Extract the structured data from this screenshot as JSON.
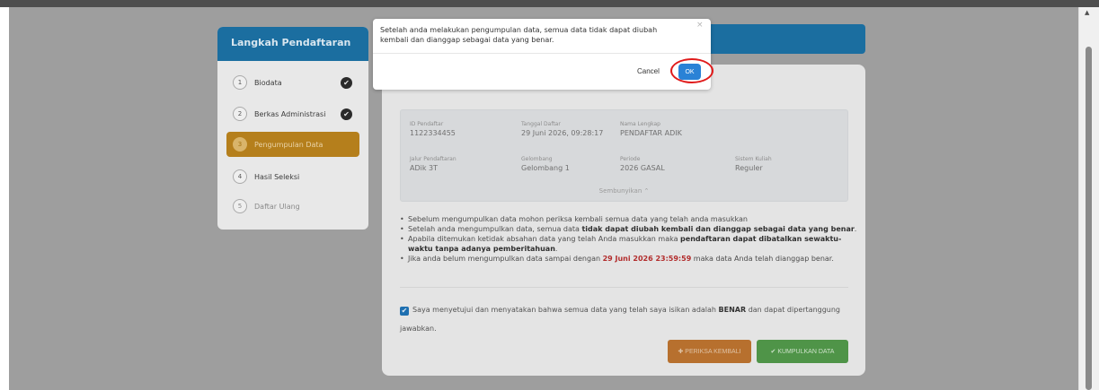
{
  "sidebar": {
    "title": "Langkah Pendaftaran",
    "steps": [
      {
        "num": "1",
        "label": "Biodata",
        "done": "✔"
      },
      {
        "num": "2",
        "label": "Berkas Administrasi",
        "done": "✔"
      },
      {
        "num": "3",
        "label": "Pengumpulan Data"
      },
      {
        "num": "4",
        "label": "Hasil Seleksi"
      },
      {
        "num": "5",
        "label": "Daftar Ulang"
      }
    ]
  },
  "info": {
    "id_label": "ID Pendaftar",
    "id_value": "1122334455",
    "date_label": "Tanggal Daftar",
    "date_value": "29 Juni 2026, 09:28:17",
    "name_label": "Nama Lengkap",
    "name_value": "PENDAFTAR ADIK",
    "jalur_label": "Jalur Pendaftaran",
    "jalur_value": "ADik 3T",
    "gel_label": "Gelombang",
    "gel_value": "Gelombang 1",
    "periode_label": "Periode",
    "periode_value": "2026 GASAL",
    "sistem_label": "Sistem Kuliah",
    "sistem_value": "Reguler",
    "hide_link": "Sembunyikan ⌃"
  },
  "notes": {
    "n1": "Sebelum mengumpulkan data mohon periksa kembali semua data yang telah anda masukkan",
    "n2_pre": "Setelah anda mengumpulkan data, semua data ",
    "n2_bold": "tidak dapat diubah kembali dan dianggap sebagai data yang benar",
    "n2_post": ".",
    "n3_pre": "Apabila ditemukan ketidak absahan data yang telah Anda masukkan maka ",
    "n3_bold": "pendaftaran dapat dibatalkan sewaktu-waktu tanpa adanya pemberitahuan",
    "n3_post": ".",
    "n4_pre": "Jika anda belum mengumpulkan data sampai dengan ",
    "n4_red": "29 Juni 2026 23:59:59",
    "n4_post": " maka data Anda telah dianggap benar."
  },
  "agreement": {
    "check": "✔",
    "pre": "Saya menyetujui dan menyatakan bahwa semua data yang telah saya isikan adalah ",
    "bold": "BENAR",
    "post": " dan dapat dipertanggung jawabkan."
  },
  "buttons": {
    "review": "✚ PERIKSA KEMBALI",
    "submit": "✔ KUMPULKAN DATA"
  },
  "modal": {
    "message": "Setelah anda melakukan pengumpulan data, semua data tidak dapat diubah kembali dan dianggap sebagai data yang benar.",
    "close": "×",
    "cancel": "Cancel",
    "ok": "OK"
  },
  "colors": {
    "primary": "#1b6ea0",
    "active_step": "#b57f1c",
    "ok_button": "#2a82d6",
    "highlight": "#e01b1b",
    "review_button": "#b7702e",
    "submit_button": "#4f9448"
  }
}
